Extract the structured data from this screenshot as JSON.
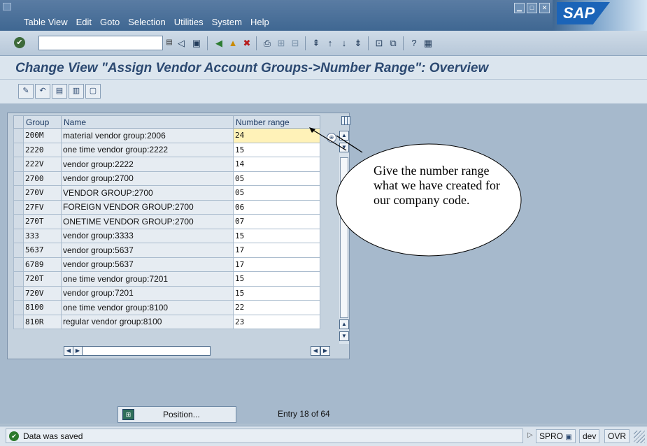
{
  "menubar": {
    "items": [
      "Table View",
      "Edit",
      "Goto",
      "Selection",
      "Utilities",
      "System",
      "Help"
    ],
    "logo": "SAP"
  },
  "toolbar": {
    "command_value": ""
  },
  "page": {
    "title": "Change View \"Assign Vendor Account Groups->Number Range\": Overview"
  },
  "table": {
    "headers": {
      "group": "Group",
      "name": "Name",
      "range": "Number range"
    },
    "rows": [
      {
        "group": "200M",
        "name": "material vendor group:2006",
        "range": "24"
      },
      {
        "group": "2220",
        "name": "one time vendor group:2222",
        "range": "15"
      },
      {
        "group": "222V",
        "name": "vendor group:2222",
        "range": "14"
      },
      {
        "group": "2700",
        "name": "vendor group:2700",
        "range": "05"
      },
      {
        "group": "270V",
        "name": "VENDOR GROUP:2700",
        "range": "05"
      },
      {
        "group": "27FV",
        "name": "FOREIGN VENDOR GROUP:2700",
        "range": "06"
      },
      {
        "group": "270T",
        "name": "ONETIME VENDOR GROUP:2700",
        "range": "07"
      },
      {
        "group": "333",
        "name": "vendor group:3333",
        "range": "15"
      },
      {
        "group": "5637",
        "name": "vendor group:5637",
        "range": "17"
      },
      {
        "group": "6789",
        "name": "vendor group:5637",
        "range": "17"
      },
      {
        "group": "720T",
        "name": "one time vendor group:7201",
        "range": "15"
      },
      {
        "group": "720V",
        "name": "vendor group:7201",
        "range": "15"
      },
      {
        "group": "8100",
        "name": "one time vendor group:8100",
        "range": "22"
      },
      {
        "group": "810R",
        "name": "regular vendor group:8100",
        "range": "23"
      }
    ]
  },
  "callout": {
    "text": "Give the number range what we have created for our company code."
  },
  "bottom": {
    "position_label": "Position...",
    "entry_text": "Entry 18 of 64"
  },
  "status": {
    "message": "Data was saved",
    "transaction": "SPRO",
    "system": "dev",
    "mode": "OVR"
  }
}
